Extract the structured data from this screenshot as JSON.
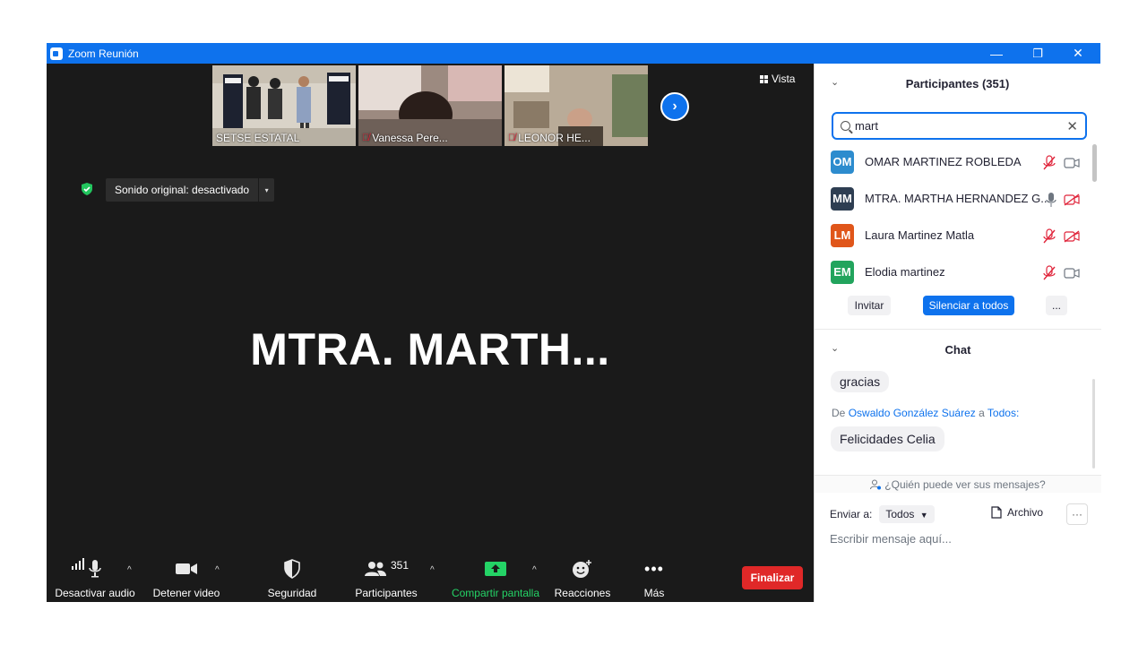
{
  "window": {
    "title": "Zoom Reunión",
    "controls": [
      "—",
      "❐",
      "✕"
    ]
  },
  "gallery": {
    "thumbnails": [
      {
        "name": "SETSE ESTATAL",
        "muted": false
      },
      {
        "name": "Vanessa Pere...",
        "muted": true
      },
      {
        "name": "LEONOR HE...",
        "muted": true
      }
    ],
    "next_icon": "›",
    "view_label": "Vista"
  },
  "audio": {
    "original_sound_label": "Sonido original: desactivado",
    "dropdown_arrow": "▾"
  },
  "active_speaker": {
    "name": "MTRA.  MARTH..."
  },
  "toolbar": {
    "audio_label": "Desactivar audio",
    "video_label": "Detener video",
    "security_label": "Seguridad",
    "participants_label": "Participantes",
    "participants_count": "351",
    "share_label": "Compartir pantalla",
    "reactions_label": "Reacciones",
    "more_label": "Más",
    "end_label": "Finalizar",
    "caret": "^"
  },
  "participants_panel": {
    "title": "Participantes (351)",
    "search_value": "mart",
    "clear_icon": "✕",
    "list": [
      {
        "initials": "OM",
        "name": "OMAR MARTINEZ ROBLEDA",
        "color": "#2d8cce",
        "mic": "muted",
        "video": "on"
      },
      {
        "initials": "MM",
        "name": "MTRA. MARTHA HERNANDEZ G...",
        "color": "#2e3e52",
        "mic": "on",
        "video": "off"
      },
      {
        "initials": "LM",
        "name": "Laura Martinez Matla",
        "color": "#e0561a",
        "mic": "muted",
        "video": "off"
      },
      {
        "initials": "EM",
        "name": "Elodia martinez",
        "color": "#22a45d",
        "mic": "muted",
        "video": "on"
      }
    ],
    "invite_label": "Invitar",
    "mute_all_label": "Silenciar a todos",
    "more_label": "..."
  },
  "chat_panel": {
    "title": "Chat",
    "messages": [
      {
        "text": "gracias"
      },
      {
        "from_prefix": "De",
        "from_name": "Oswaldo González Suárez",
        "to_prefix": "a",
        "to_name": "Todos:",
        "text": "Felicidades Celia"
      }
    ],
    "who_can_see": "¿Quién puede ver sus mensajes?",
    "send_to_label": "Enviar a:",
    "send_to_value": "Todos",
    "file_label": "Archivo",
    "more_label": "···",
    "input_placeholder": "Escribir mensaje aquí..."
  },
  "colors": {
    "zoom_blue": "#0e72ed",
    "stage_bg": "#1a1a1a",
    "end_red": "#e02828",
    "share_green": "#24d366",
    "muted_red": "#e0243a"
  }
}
